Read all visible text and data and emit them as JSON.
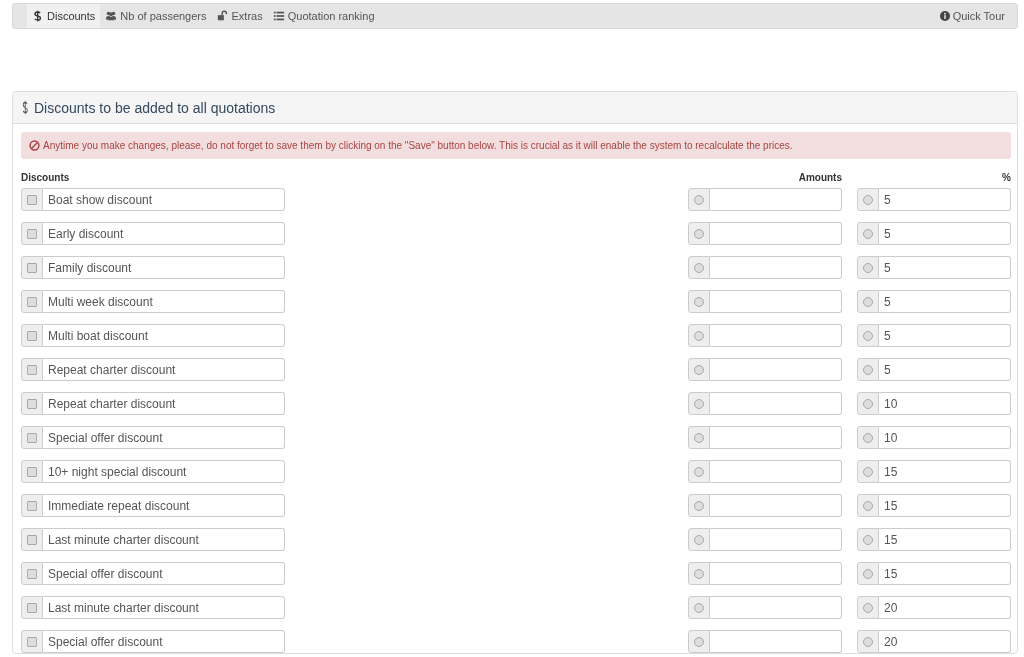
{
  "nav": {
    "tabs": [
      {
        "label": "Discounts",
        "selected": true
      },
      {
        "label": "Nb of passengers",
        "selected": false
      },
      {
        "label": "Extras",
        "selected": false
      },
      {
        "label": "Quotation ranking",
        "selected": false
      }
    ],
    "quick_tour": "Quick Tour"
  },
  "panel": {
    "title": "Discounts to be added to all quotations",
    "alert": "Anytime you make changes, please, do not forget to save them by clicking on the \"Save\" button below. This is crucial as it will enable the system to recalculate the prices.",
    "columns": [
      "Discounts",
      "Amounts",
      "%"
    ],
    "rows": [
      {
        "name": "Boat show discount",
        "checked": false,
        "amount_selected": false,
        "amount": "",
        "percent_selected": false,
        "percent": "5"
      },
      {
        "name": "Early discount",
        "checked": false,
        "amount_selected": false,
        "amount": "",
        "percent_selected": false,
        "percent": "5"
      },
      {
        "name": "Family discount",
        "checked": false,
        "amount_selected": false,
        "amount": "",
        "percent_selected": false,
        "percent": "5"
      },
      {
        "name": "Multi week discount",
        "checked": false,
        "amount_selected": false,
        "amount": "",
        "percent_selected": false,
        "percent": "5"
      },
      {
        "name": "Multi boat discount",
        "checked": false,
        "amount_selected": false,
        "amount": "",
        "percent_selected": false,
        "percent": "5"
      },
      {
        "name": "Repeat charter discount",
        "checked": false,
        "amount_selected": false,
        "amount": "",
        "percent_selected": false,
        "percent": "5"
      },
      {
        "name": "Repeat charter discount",
        "checked": false,
        "amount_selected": false,
        "amount": "",
        "percent_selected": false,
        "percent": "10"
      },
      {
        "name": "Special offer discount",
        "checked": false,
        "amount_selected": false,
        "amount": "",
        "percent_selected": false,
        "percent": "10"
      },
      {
        "name": "10+ night special discount",
        "checked": false,
        "amount_selected": false,
        "amount": "",
        "percent_selected": false,
        "percent": "15"
      },
      {
        "name": "Immediate repeat discount",
        "checked": false,
        "amount_selected": false,
        "amount": "",
        "percent_selected": false,
        "percent": "15"
      },
      {
        "name": "Last minute charter discount",
        "checked": false,
        "amount_selected": false,
        "amount": "",
        "percent_selected": false,
        "percent": "15"
      },
      {
        "name": "Special offer discount",
        "checked": false,
        "amount_selected": false,
        "amount": "",
        "percent_selected": false,
        "percent": "15"
      },
      {
        "name": "Last minute charter discount",
        "checked": false,
        "amount_selected": false,
        "amount": "",
        "percent_selected": false,
        "percent": "20"
      },
      {
        "name": "Special offer discount",
        "checked": false,
        "amount_selected": false,
        "amount": "",
        "percent_selected": false,
        "percent": "20"
      }
    ]
  }
}
